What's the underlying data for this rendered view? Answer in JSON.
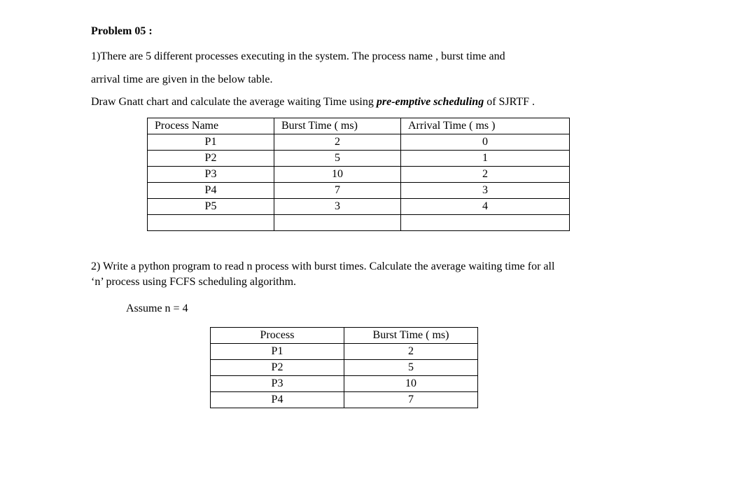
{
  "heading": "Problem 05 :",
  "q1_line1": "1)There are 5 different processes executing in the system. The process name , burst time and",
  "q1_line2": "arrival time are given in the below table.",
  "q1_line3a": "Draw Gnatt chart and calculate the average waiting Time using ",
  "q1_line3b": "pre-emptive  scheduling",
  "q1_line3c": " of  SJRTF .",
  "table1": {
    "headers": {
      "c1": "Process Name",
      "c2": "Burst Time ( ms)",
      "c3": "Arrival Time ( ms )"
    },
    "rows": [
      {
        "c1": "P1",
        "c2": "2",
        "c3": "0"
      },
      {
        "c1": "P2",
        "c2": "5",
        "c3": "1"
      },
      {
        "c1": "P3",
        "c2": "10",
        "c3": "2"
      },
      {
        "c1": "P4",
        "c2": "7",
        "c3": "3"
      },
      {
        "c1": "P5",
        "c2": "3",
        "c3": "4"
      },
      {
        "c1": "",
        "c2": "",
        "c3": ""
      }
    ]
  },
  "q2_line1": "2) Write a python program to read n process with burst times. Calculate the average waiting time for all",
  "q2_line2": "‘n’ process using FCFS scheduling algorithm.",
  "assume": "Assume n = 4",
  "table2": {
    "headers": {
      "c1": "Process",
      "c2": "Burst Time ( ms)"
    },
    "rows": [
      {
        "c1": "P1",
        "c2": "2"
      },
      {
        "c1": "P2",
        "c2": "5"
      },
      {
        "c1": "P3",
        "c2": "10"
      },
      {
        "c1": "P4",
        "c2": "7"
      }
    ]
  }
}
